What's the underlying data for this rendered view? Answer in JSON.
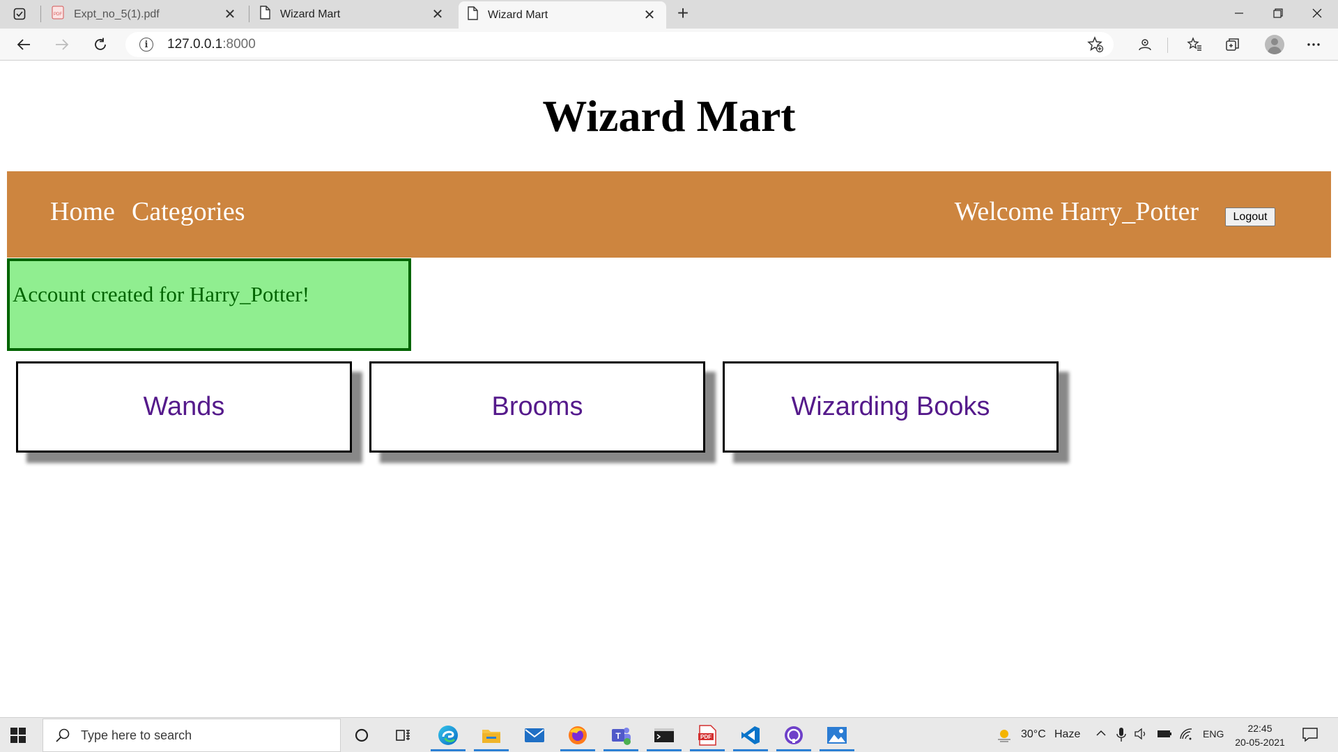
{
  "browser": {
    "tabs": [
      {
        "title": "Expt_no_5(1).pdf",
        "icon": "pdf-file-icon",
        "active": false
      },
      {
        "title": "Wizard Mart",
        "icon": "page-icon",
        "active": false
      },
      {
        "title": "Wizard Mart",
        "icon": "page-icon",
        "active": true
      }
    ],
    "url_host": "127.0.0.1",
    "url_port": ":8000"
  },
  "site": {
    "title": "Wizard Mart",
    "nav": {
      "home": "Home",
      "categories": "Categories",
      "welcome": "Welcome Harry_Potter",
      "logout": "Logout"
    },
    "alert": "Account created for Harry_Potter!",
    "categories": [
      "Wands",
      "Brooms",
      "Wizarding Books"
    ]
  },
  "taskbar": {
    "search_placeholder": "Type here to search",
    "weather": "30°C",
    "weather_desc": "Haze",
    "language": "ENG",
    "time": "22:45",
    "date": "20-05-2021"
  },
  "colors": {
    "navbar": "#cd853f",
    "alert_bg": "#90ee90",
    "alert_border": "#006400",
    "card_text": "#551a8b"
  }
}
